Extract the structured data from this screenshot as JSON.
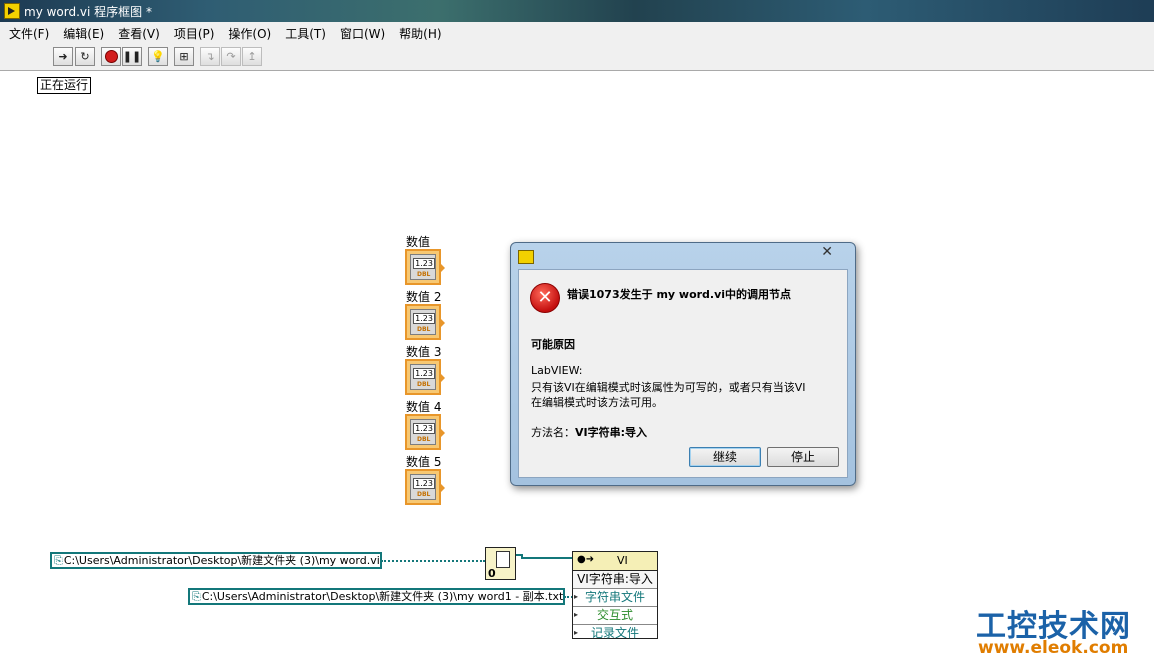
{
  "window": {
    "title": "my word.vi 程序框图 *"
  },
  "menu": [
    "文件(F)",
    "编辑(E)",
    "查看(V)",
    "项目(P)",
    "操作(O)",
    "工具(T)",
    "窗口(W)",
    "帮助(H)"
  ],
  "toolbar": {
    "buttons": [
      "run-icon",
      "run-continuously-icon",
      "abort-icon",
      "pause-icon",
      "highlight-execution-icon",
      "retain-wire-values-icon",
      "step-into-icon",
      "step-over-icon",
      "step-out-icon"
    ]
  },
  "diagram": {
    "status_label": "正在运行",
    "numerics": [
      {
        "label": "数值",
        "value": "1.23",
        "type": "DBL"
      },
      {
        "label": "数值 2",
        "value": "1.23",
        "type": "DBL"
      },
      {
        "label": "数值 3",
        "value": "1.23",
        "type": "DBL"
      },
      {
        "label": "数值 4",
        "value": "1.23",
        "type": "DBL"
      },
      {
        "label": "数值 5",
        "value": "1.23",
        "type": "DBL"
      }
    ],
    "path1": "C:\\Users\\Administrator\\Desktop\\新建文件夹 (3)\\my word.vi",
    "path2": "C:\\Users\\Administrator\\Desktop\\新建文件夹 (3)\\my word1 - 副本.txt",
    "open_ref_constant": "0",
    "invoke_node": {
      "class": "VI",
      "method": "VI字符串:导入",
      "params": [
        "字符串文件",
        "交互式",
        "记录文件"
      ]
    }
  },
  "dialog": {
    "error_title": "错误1073发生于 my word.vi中的调用节点",
    "cause_heading": "可能原因",
    "cause_lines": [
      "LabVIEW:",
      "只有该VI在编辑模式时该属性为可写的，或者只有当该VI",
      "在编辑模式时该方法可用。"
    ],
    "method_label": "方法名：",
    "method_name": "VI字符串:导入",
    "continue_label": "继续",
    "stop_label": "停止"
  },
  "watermark": {
    "top": "工控技术网",
    "bottom": "www.eleok.com"
  },
  "colors": {
    "path_wire": "#13777a",
    "numeric_orange": "#e8962a",
    "dialog_frame": "#a4c2df"
  }
}
